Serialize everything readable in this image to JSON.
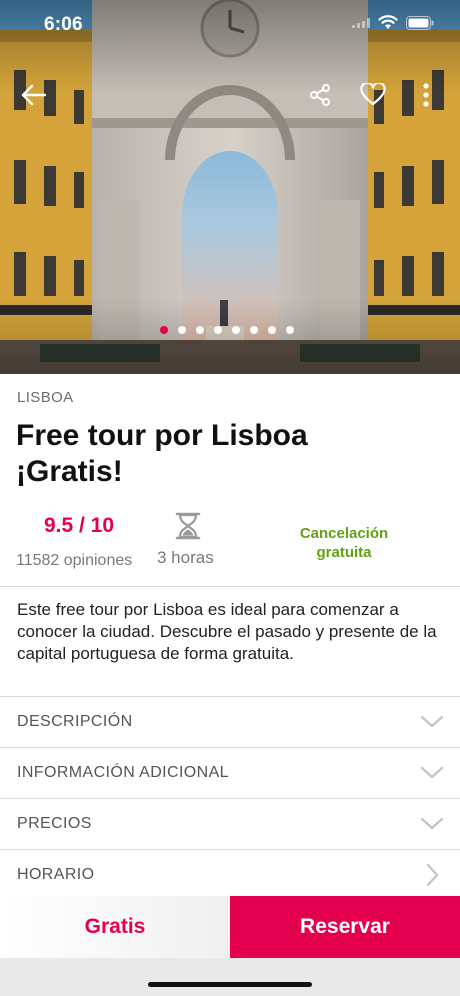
{
  "status_bar": {
    "time": "6:06"
  },
  "hero": {
    "gallery_count": 8,
    "active_index": 0
  },
  "tour": {
    "city": "LISBOA",
    "title_line1": "Free tour por Lisboa",
    "title_line2": "¡Gratis!",
    "rating": "9.5 / 10",
    "reviews": "11582 opiniones",
    "duration": "3 horas",
    "cancellation_line1": "Cancelación",
    "cancellation_line2": "gratuita",
    "description": "Este free tour por Lisboa es ideal para comenzar a conocer la ciudad. Descubre el pasado y presente de la capital portuguesa de forma gratuita."
  },
  "sections": [
    {
      "label": "DESCRIPCIÓN",
      "chevron": "chevron-down-icon"
    },
    {
      "label": "INFORMACIÓN ADICIONAL",
      "chevron": "chevron-down-icon"
    },
    {
      "label": "PRECIOS",
      "chevron": "chevron-down-icon"
    },
    {
      "label": "HORARIO",
      "chevron": "chevron-right-icon"
    }
  ],
  "footer": {
    "price": "Gratis",
    "reserve_label": "Reservar"
  },
  "colors": {
    "accent": "#e5004f",
    "success": "#5fa213"
  }
}
